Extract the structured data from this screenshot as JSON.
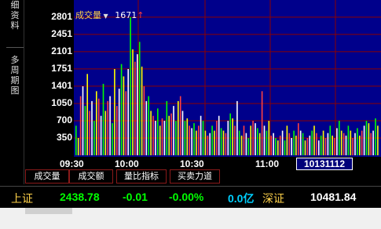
{
  "sidebar": {
    "tabs": [
      {
        "label": "细资料",
        "chars": [
          "细",
          "资",
          "料"
        ]
      },
      {
        "label": "多周期图",
        "chars": [
          "多",
          "周",
          "期",
          "图"
        ]
      }
    ]
  },
  "indicator": {
    "name": "成交量",
    "dropdown_icon": "triangle-down",
    "value": "1671",
    "trend_icon": "arrow-up",
    "colors": {
      "name": "#ffd24a",
      "trend": "#ff3b3b"
    }
  },
  "chart_data": {
    "type": "bar",
    "ylabel": "",
    "xlabel": "",
    "y_ticks": [
      "2801",
      "2451",
      "2101",
      "1751",
      "1401",
      "1050",
      "700",
      "350"
    ],
    "y_tick_values": [
      2801,
      2451,
      2101,
      1751,
      1401,
      1050,
      700,
      350
    ],
    "ylim": [
      0,
      3150
    ],
    "x_ticks": [
      "09:30",
      "10:00",
      "10:30",
      "11:00"
    ],
    "x_highlight": "10131112",
    "series": [
      {
        "colors": [
          "#00ff00",
          "#ffff00",
          "#ff4040",
          "#ffffff"
        ],
        "values": [
          600,
          350,
          1200,
          1400,
          1000,
          1650,
          900,
          1100,
          700,
          1300,
          1150,
          800,
          1450,
          900,
          1100,
          1200,
          650,
          1750,
          1000,
          1350,
          1850,
          1600,
          1300,
          1750,
          2800,
          2150,
          1900,
          2050,
          2300,
          1800,
          1400,
          1100,
          1200,
          900,
          800,
          700,
          950,
          600,
          750,
          700,
          1100,
          800,
          850,
          1000,
          700,
          1100,
          1200,
          900,
          700,
          750,
          600,
          550,
          650,
          500,
          600,
          800,
          700,
          500,
          400,
          450,
          600,
          500,
          700,
          800,
          550,
          500,
          450,
          700,
          850,
          750,
          600,
          1100,
          500,
          400,
          600,
          450,
          350,
          600,
          700,
          650,
          550,
          450,
          1300,
          600,
          500,
          700,
          400,
          450,
          350,
          300,
          400,
          500,
          300,
          600,
          450,
          350,
          500,
          400,
          650,
          500,
          450,
          300,
          350,
          400,
          500,
          600,
          450,
          300,
          400,
          500,
          350,
          450,
          600,
          400,
          350,
          550,
          700,
          500,
          450,
          400,
          600,
          500,
          350,
          450,
          550,
          400,
          500,
          600,
          700,
          650,
          450,
          500,
          750,
          600
        ]
      }
    ],
    "grid": true,
    "background": "#00008b",
    "grid_color": "#8b0000"
  },
  "tabs": [
    "成交量",
    "成交额",
    "量比指标",
    "买卖力道"
  ],
  "status": {
    "sh_label": "上证",
    "sh_index": "2438.78",
    "sh_change": "-0.01",
    "sh_pct": "-0.00%",
    "sh_vol": "0.0亿",
    "sz_label": "深证",
    "sz_index": "10481.84",
    "colors": {
      "label": "#ffd24a",
      "value": "#00ff00",
      "vol": "#00d0ff"
    }
  }
}
